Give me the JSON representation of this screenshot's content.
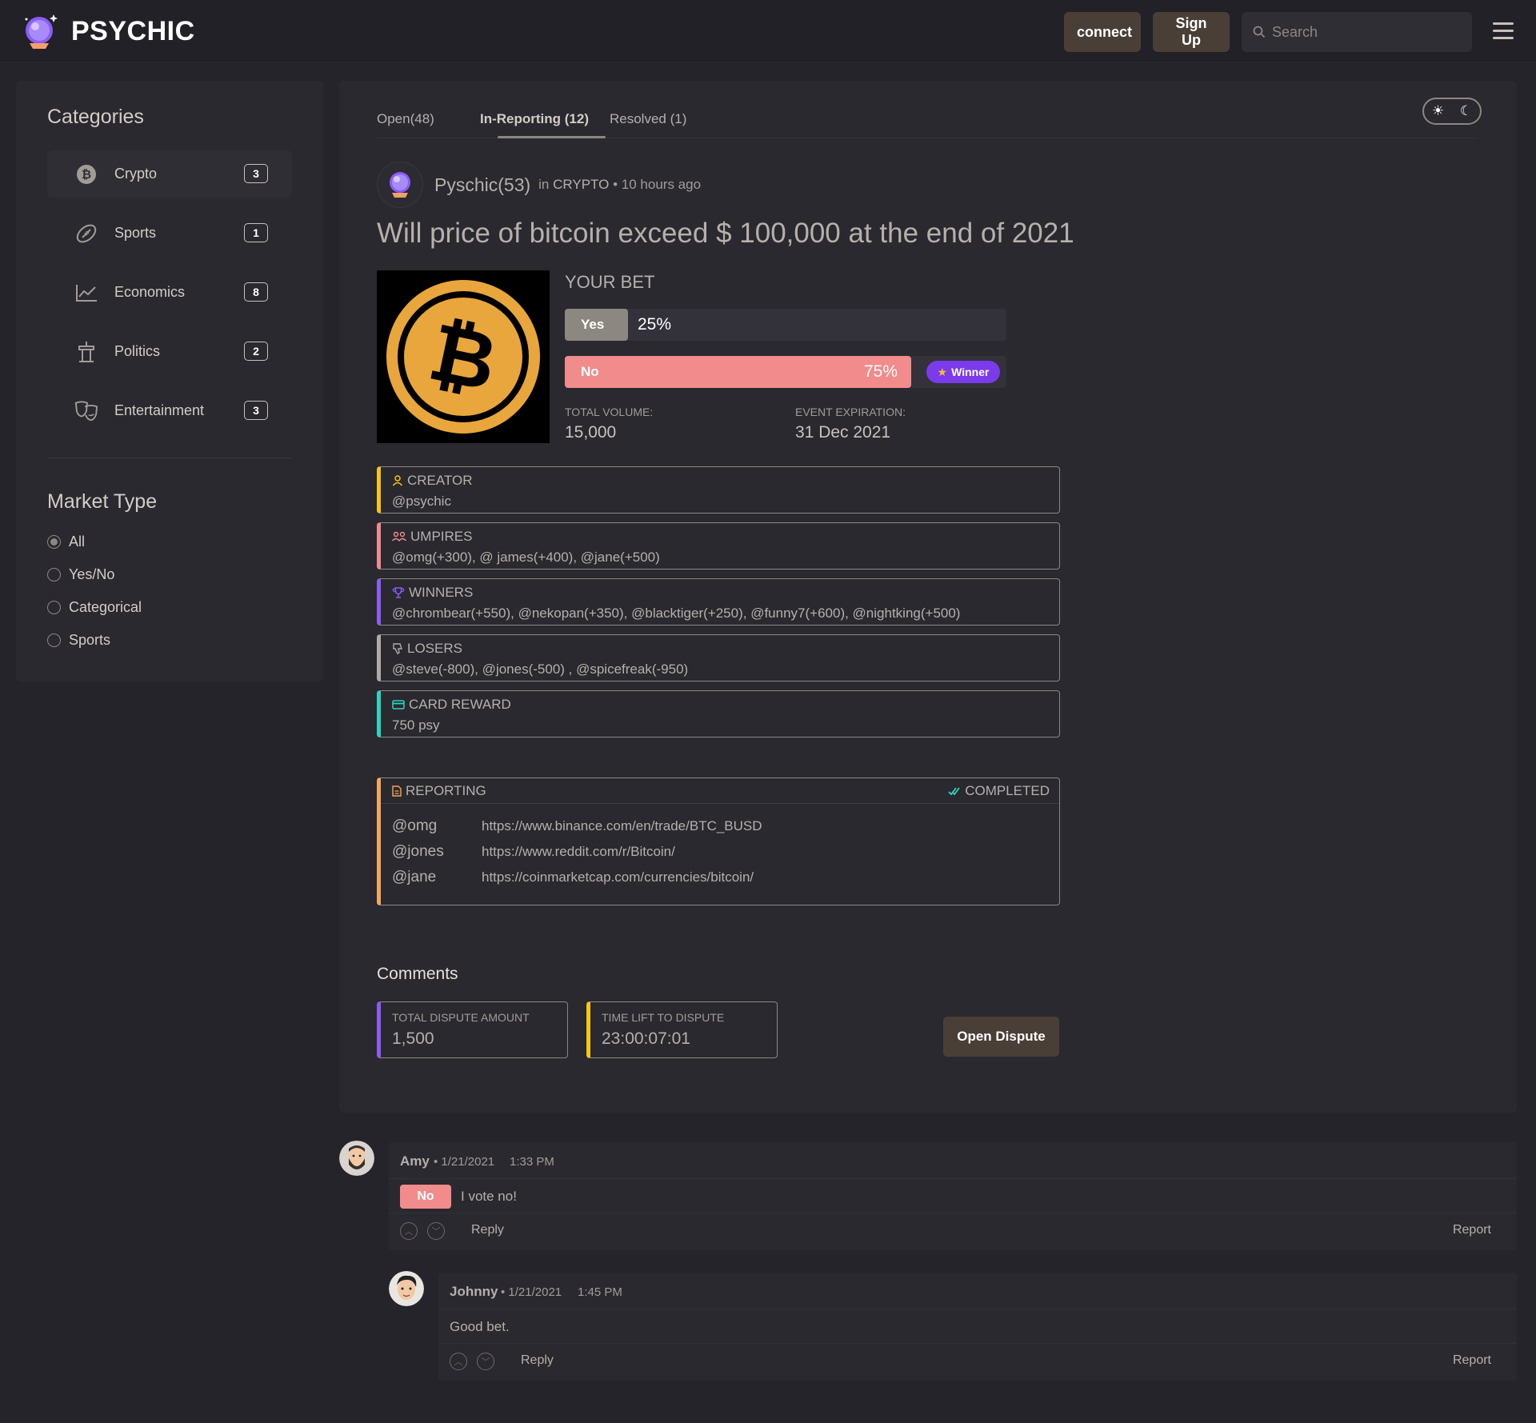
{
  "brand": {
    "name": "PSYCHIC"
  },
  "header": {
    "connect_label": "connect",
    "signup_label": "Sign Up",
    "search_placeholder": "Search"
  },
  "sidebar": {
    "categories_title": "Categories",
    "categories": [
      {
        "label": "Crypto",
        "count": "3",
        "icon": "bitcoin-icon"
      },
      {
        "label": "Sports",
        "count": "1",
        "icon": "football-icon"
      },
      {
        "label": "Economics",
        "count": "8",
        "icon": "chart-icon"
      },
      {
        "label": "Politics",
        "count": "2",
        "icon": "podium-icon"
      },
      {
        "label": "Entertainment",
        "count": "3",
        "icon": "theater-masks-icon"
      }
    ],
    "market_type_title": "Market Type",
    "market_types": [
      {
        "label": "All",
        "checked": true
      },
      {
        "label": "Yes/No",
        "checked": false
      },
      {
        "label": "Categorical",
        "checked": false
      },
      {
        "label": "Sports",
        "checked": false
      }
    ]
  },
  "tabs": [
    {
      "label": "Open(48)"
    },
    {
      "label": "In-Reporting (12)",
      "active": true
    },
    {
      "label": "Resolved (1)"
    }
  ],
  "post": {
    "author": "Pyschic(53)",
    "in_label": "in",
    "category": "CRYPTO",
    "time": "10 hours ago",
    "question": "Will price of bitcoin exceed $ 100,000 at the end of 2021",
    "your_bet_label": "YOUR BET",
    "yes_label": "Yes",
    "yes_pct": "25%",
    "yes_value": 0.25,
    "no_label": "No",
    "no_pct": "75%",
    "no_value": 0.75,
    "winner_label": "Winner",
    "total_volume_label": "TOTAL VOLUME:",
    "total_volume": "15,000",
    "expiration_label": "EVENT EXPIRATION:",
    "expiration": "31 Dec 2021"
  },
  "info_cards": [
    {
      "title": "CREATOR",
      "value": "@psychic",
      "color": "#f5c518",
      "icon": "user-icon"
    },
    {
      "title": "UMPIRES",
      "value": "@omg(+300), @ james(+400), @jane(+500)",
      "color": "#f28b8b",
      "icon": "users-icon"
    },
    {
      "title": "WINNERS",
      "value": " @chrombear(+550), @nekopan(+350), @blacktiger(+250), @funny7(+600), @nightking(+500)",
      "color": "#8b5cf6",
      "icon": "trophy-icon"
    },
    {
      "title": "LOSERS",
      "value": " @steve(-800), @jones(-500) , @spicefreak(-950)",
      "color": "#b0aba5",
      "icon": "thumbs-down-icon"
    },
    {
      "title": "CARD REWARD",
      "value": "750 psy",
      "color": "#2dd4bf",
      "icon": "card-icon"
    }
  ],
  "reporting": {
    "title": "REPORTING",
    "status": "COMPLETED",
    "rows": [
      {
        "user": "@omg",
        "link": "https://www.binance.com/en/trade/BTC_BUSD"
      },
      {
        "user": "@jones",
        "link": "https://www.reddit.com/r/Bitcoin/"
      },
      {
        "user": "@jane",
        "link": "https://coinmarketcap.com/currencies/bitcoin/"
      }
    ]
  },
  "comments_section": {
    "title": "Comments",
    "dispute_amount_label": "TOTAL DISPUTE AMOUNT",
    "dispute_amount": "1,500",
    "time_left_label": "TIME LIFT TO DISPUTE",
    "time_left": "23:00:07:01",
    "open_dispute_label": "Open Dispute"
  },
  "comments": [
    {
      "name": "Amy",
      "date": "1/21/2021",
      "time": "1:33 PM",
      "tag": "No",
      "text": "I vote no!",
      "reply_label": "Reply",
      "report_label": "Report"
    },
    {
      "name": "Johnny",
      "date": "1/21/2021",
      "time": "1:45 PM",
      "text": "Good bet.",
      "reply_label": "Reply",
      "report_label": "Report"
    }
  ]
}
